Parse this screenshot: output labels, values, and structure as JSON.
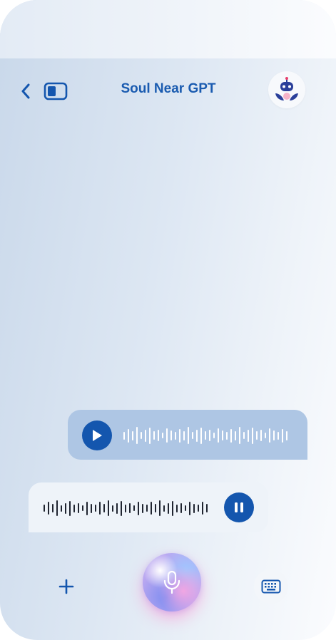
{
  "header": {
    "title": "Soul Near GPT"
  },
  "icons": {
    "back": "chevron-left-icon",
    "panel": "sidebar-panel-icon",
    "avatar": "robot-avatar-icon",
    "play": "play-icon",
    "pause": "pause-icon",
    "plus": "plus-icon",
    "mic": "microphone-icon",
    "keyboard": "keyboard-icon"
  },
  "colors": {
    "accent": "#1456ae",
    "title": "#1a5bb0",
    "outgoing_bubble": "#aec6e4",
    "incoming_bubble": "#eef3f9"
  },
  "messages": [
    {
      "type": "voice",
      "direction": "outgoing",
      "state": "paused"
    },
    {
      "type": "voice",
      "direction": "incoming",
      "state": "playing"
    }
  ]
}
